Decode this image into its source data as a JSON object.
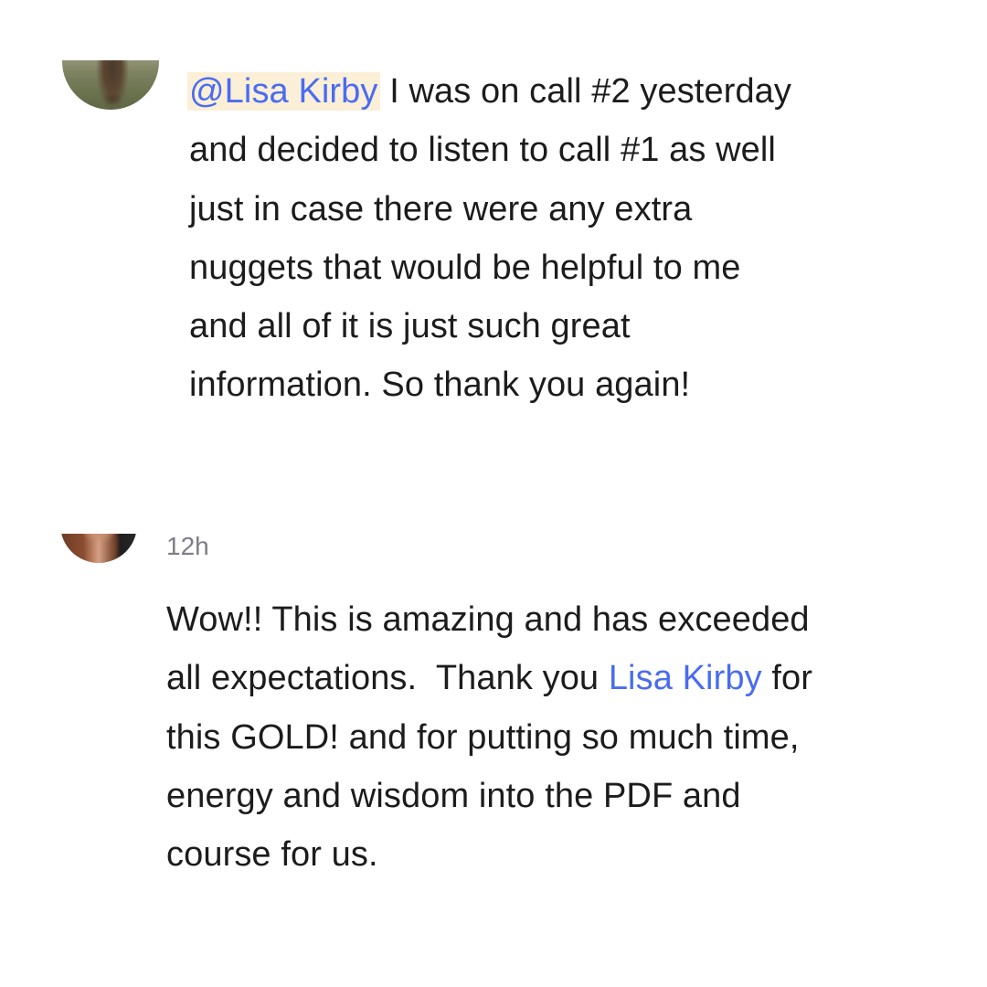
{
  "comments": [
    {
      "timestamp": "",
      "mention": "@Lisa Kirby",
      "lines": [
        " I was on call #2 yesterday",
        "and decided to listen to call #1 as well",
        "just in case there were any extra",
        "nuggets that would be helpful to me",
        "and all of it is just such great",
        "information. So thank you again!"
      ]
    },
    {
      "timestamp": "12h",
      "line1": "Wow!! This is amazing and has exceeded",
      "line2_before": "all expectations.  Thank you ",
      "line2_link": "Lisa Kirby",
      "line2_after": " for",
      "lines": [
        "this GOLD! and for putting so much time,",
        "energy and wisdom into the PDF and",
        "course for us."
      ]
    }
  ],
  "colors": {
    "link": "#4a6cf0",
    "mention_highlight": "#fbefd8",
    "text": "#1c1c1e",
    "timestamp": "#7d7d85"
  }
}
